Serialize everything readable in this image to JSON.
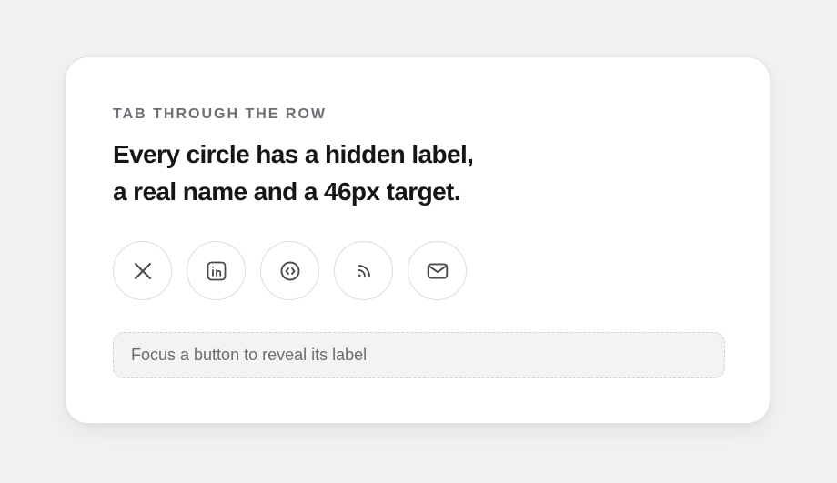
{
  "card": {
    "eyebrow": "TAB THROUGH THE ROW",
    "headline_line1": "Every circle has a hidden label,",
    "headline_line2": "a real name and a 46px target."
  },
  "buttons": [
    {
      "icon": "x-icon",
      "label": "X"
    },
    {
      "icon": "linkedin-icon",
      "label": "LinkedIn"
    },
    {
      "icon": "code-icon",
      "label": "Code"
    },
    {
      "icon": "rss-icon",
      "label": "RSS"
    },
    {
      "icon": "mail-icon",
      "label": "Email"
    }
  ],
  "status": {
    "text": "Focus a button to reveal its label"
  },
  "colors": {
    "background": "#f2f2f4",
    "card": "#ffffff",
    "text": "#16161a",
    "muted": "#6e6e74",
    "border": "#dcdcdf"
  }
}
